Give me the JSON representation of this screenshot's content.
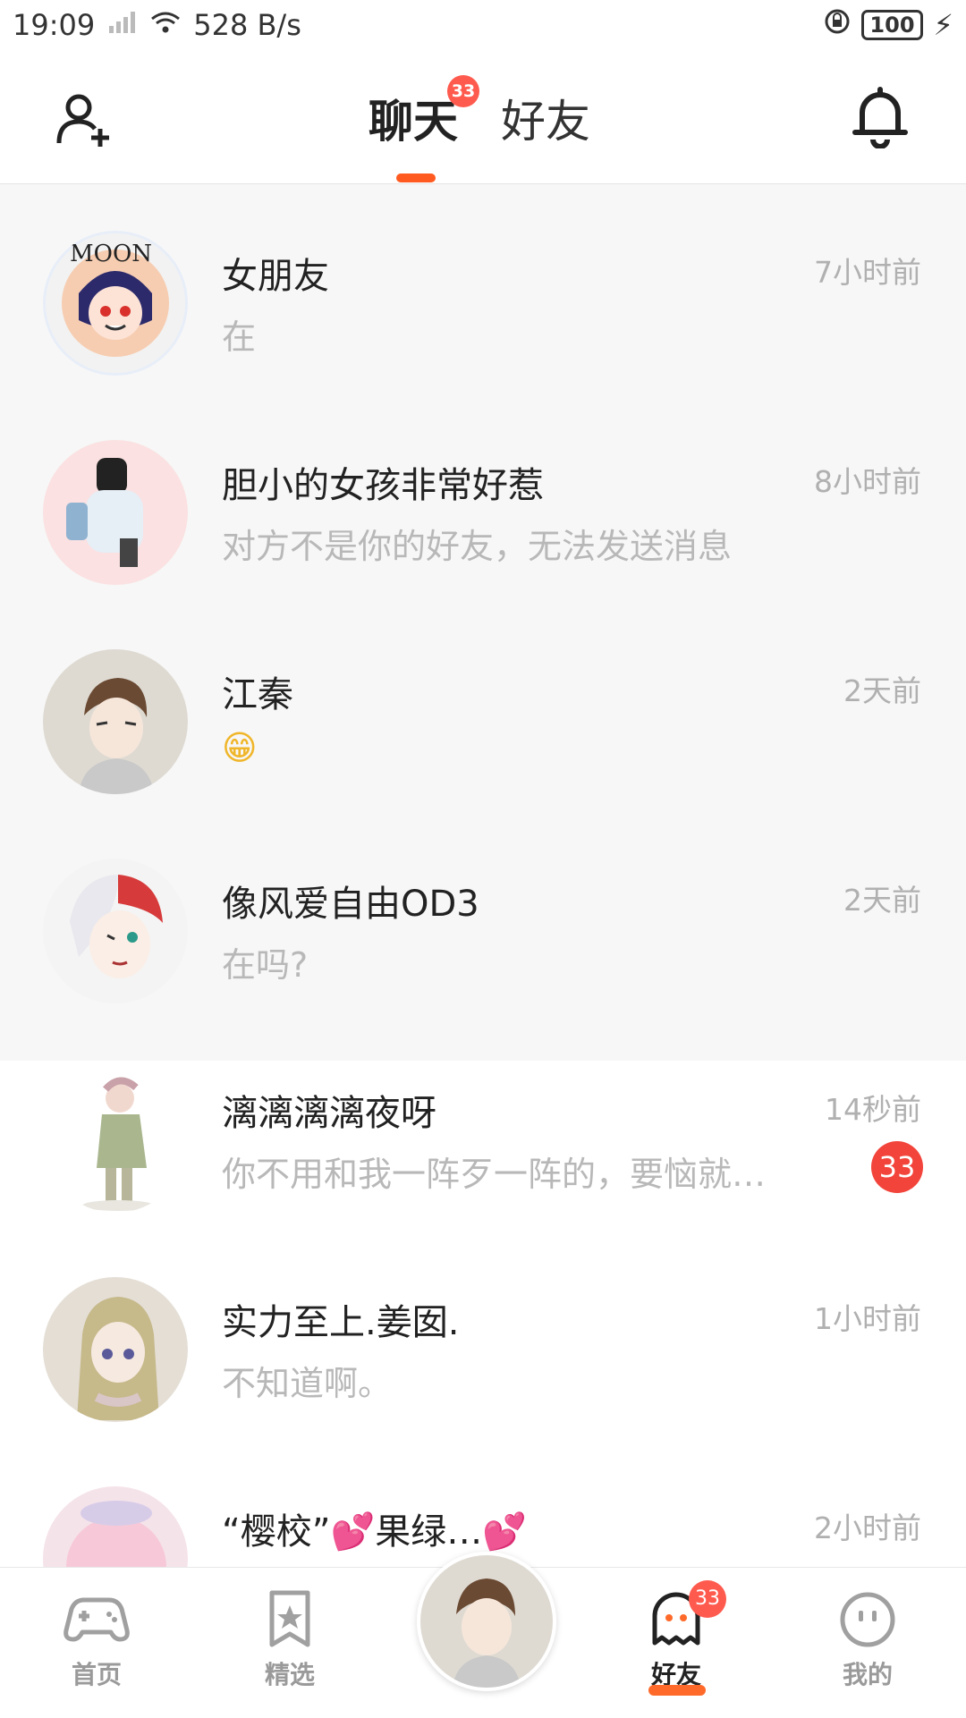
{
  "status_bar": {
    "time": "19:09",
    "network_speed": "528 B/s",
    "battery": "100"
  },
  "header": {
    "tabs": [
      {
        "label": "聊天",
        "badge": "33"
      },
      {
        "label": "好友"
      }
    ]
  },
  "chats": [
    {
      "name": "女朋友",
      "time": "7小时前",
      "preview": "在",
      "pinned": true
    },
    {
      "name": "胆小的女孩非常好惹",
      "time": "8小时前",
      "preview": "对方不是你的好友，无法发送消息",
      "pinned": true
    },
    {
      "name": "江秦",
      "time": "2天前",
      "preview": "😁",
      "pinned": true
    },
    {
      "name": "像风爱自由OD3",
      "time": "2天前",
      "preview": "在吗?",
      "pinned": true
    },
    {
      "name": "漓漓漓漓夜呀",
      "time": "14秒前",
      "preview": "你不用和我一阵歹一阵的，要恼就…",
      "unread": "33",
      "pinned": false
    },
    {
      "name": "实力至上.姜囡.",
      "time": "1小时前",
      "preview": "不知道啊。",
      "pinned": false
    },
    {
      "name": "“樱校”💕果绿…💕",
      "time": "2小时前",
      "preview": "",
      "pinned": false
    }
  ],
  "bottom_nav": {
    "items": [
      {
        "label": "首页",
        "icon": "gamepad-icon"
      },
      {
        "label": "精选",
        "icon": "star-bookmark-icon"
      },
      {
        "label": "好友",
        "icon": "ghost-icon",
        "badge": "33",
        "active": true
      },
      {
        "label": "我的",
        "icon": "smiley-icon"
      }
    ]
  },
  "colors": {
    "accent": "#ff5a1f",
    "badge": "#ff5a4e",
    "pinned_bg": "#f7f7f7"
  }
}
